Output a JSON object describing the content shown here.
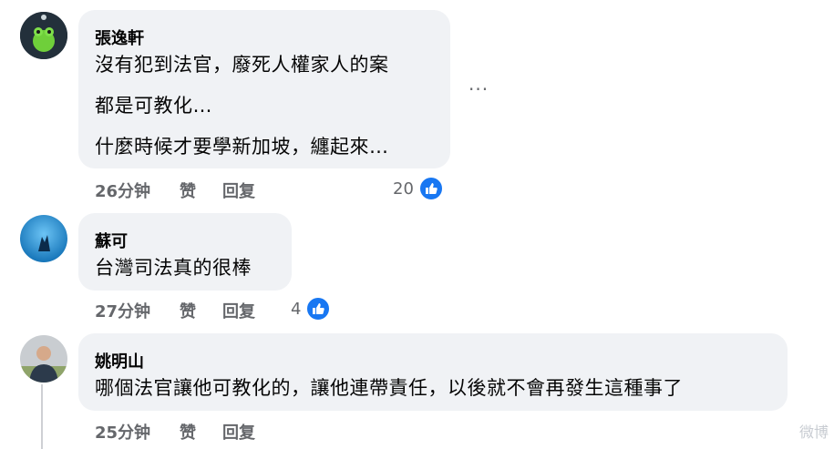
{
  "comments": [
    {
      "author": "張逸軒",
      "lines": [
        "沒有犯到法官，廢死人權家人的案",
        "都是可教化…",
        "什麼時候才要學新加坡，纏起來…"
      ],
      "time": "26分钟",
      "like_label": "赞",
      "reply_label": "回复",
      "reaction_count": "20",
      "more_label": "···"
    },
    {
      "author": "蘇可",
      "lines": [
        "台灣司法真的很棒"
      ],
      "time": "27分钟",
      "like_label": "赞",
      "reply_label": "回复",
      "reaction_count": "4"
    },
    {
      "author": "姚明山",
      "lines": [
        "哪個法官讓他可教化的，讓他連帶責任，以後就不會再發生這種事了"
      ],
      "time": "25分钟",
      "like_label": "赞",
      "reply_label": "回复"
    }
  ],
  "watermark": "微博",
  "colors": {
    "bubble": "#f0f2f5",
    "meta_text": "#65676b",
    "like_blue": "#1877f2"
  }
}
